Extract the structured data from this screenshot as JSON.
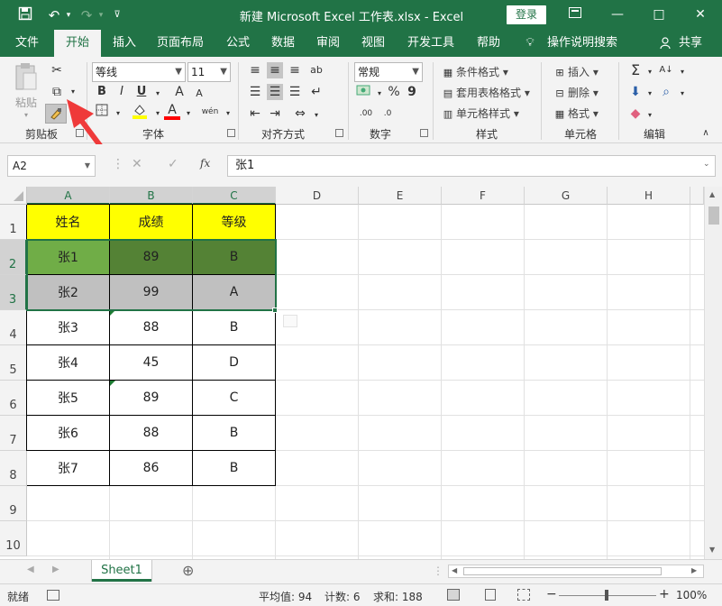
{
  "window": {
    "title": "新建 Microsoft Excel 工作表.xlsx  -  Excel",
    "login_label": "登录",
    "controls": {
      "minimize": "—",
      "restore": "□",
      "close": "✕"
    }
  },
  "tabs": [
    "文件",
    "开始",
    "插入",
    "页面布局",
    "公式",
    "数据",
    "审阅",
    "视图",
    "开发工具",
    "帮助",
    "操作说明搜索"
  ],
  "share_label": "共享",
  "ribbon": {
    "clipboard": {
      "paste_label": "粘贴",
      "group_label": "剪贴板"
    },
    "font": {
      "font_name": "等线",
      "font_size": "11",
      "bold": "B",
      "italic": "I",
      "underline": "U",
      "grow": "A",
      "shrink": "A",
      "font_color": "A",
      "phonetic": "wén",
      "group_label": "字体"
    },
    "alignment": {
      "group_label": "对齐方式"
    },
    "number": {
      "format": "常规",
      "percent": "%",
      "comma": "9",
      "group_label": "数字"
    },
    "styles": {
      "conditional": "条件格式",
      "table": "套用表格格式",
      "cell_styles": "单元格样式",
      "group_label": "样式"
    },
    "cells": {
      "insert": "插入",
      "delete": "删除",
      "format": "格式",
      "group_label": "单元格"
    },
    "editing": {
      "group_label": "编辑"
    }
  },
  "formula_bar": {
    "name_box": "A2",
    "fx": "fx",
    "content": "张1"
  },
  "columns": [
    "A",
    "B",
    "C",
    "D",
    "E",
    "F",
    "G",
    "H"
  ],
  "rows": [
    "1",
    "2",
    "3",
    "4",
    "5",
    "6",
    "7",
    "8",
    "9",
    "10"
  ],
  "table": {
    "header": [
      "姓名",
      "成绩",
      "等级"
    ],
    "rows": [
      [
        "张1",
        "89",
        "B"
      ],
      [
        "张2",
        "99",
        "A"
      ],
      [
        "张3",
        "88",
        "B"
      ],
      [
        "张4",
        "45",
        "D"
      ],
      [
        "张5",
        "89",
        "C"
      ],
      [
        "张6",
        "88",
        "B"
      ],
      [
        "张7",
        "86",
        "B"
      ]
    ]
  },
  "colors": {
    "excel_green": "#217346",
    "header_fill": "#ffff00",
    "row2_col_a": "#70ad47",
    "row2_col_bc": "#548235",
    "row3_fill": "#c0c0c0"
  },
  "sheet": {
    "name": "Sheet1",
    "add": "⊕"
  },
  "status": {
    "ready": "就绪",
    "average": "平均值: 94",
    "count": "计数: 6",
    "sum": "求和: 188",
    "zoom": "100%"
  }
}
